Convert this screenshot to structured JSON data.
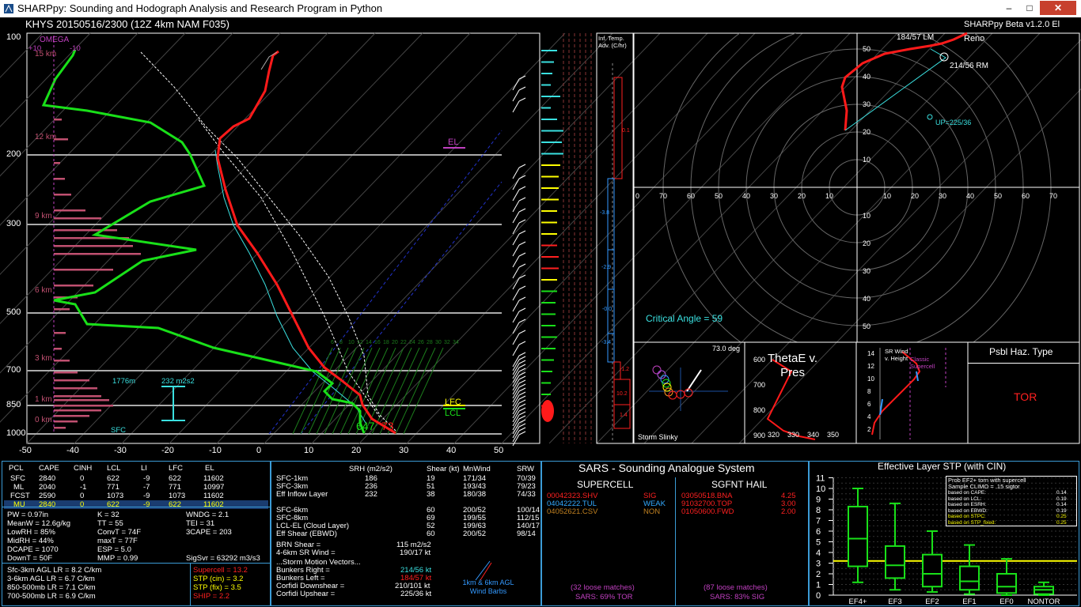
{
  "window": {
    "title": "SHARPpy: Sounding and Hodograph Analysis and Research Program in Python",
    "min": "–",
    "max": "□",
    "close": "✕"
  },
  "header": {
    "station": "KHYS   20150516/2300  (12Z  4km NAM  F035)",
    "version": "SHARPpy Beta v1.2.0 El Reno"
  },
  "skewt": {
    "p_labels": [
      "100",
      "200",
      "300",
      "500",
      "700",
      "850",
      "1000"
    ],
    "t_labels": [
      "-50",
      "-40",
      "-30",
      "-20",
      "-10",
      "0",
      "10",
      "20",
      "30",
      "40",
      "50"
    ],
    "h_labels": [
      "15 km",
      "12 km",
      "9 km",
      "6 km",
      "3 km",
      "1 km",
      "0 km"
    ],
    "omega": "OMEGA",
    "omega_ticks": [
      "+10",
      "-10"
    ],
    "el": "EL",
    "lfc": "LFC",
    "lcl": "LCL",
    "sfc": "SFC",
    "eff_h": "1776m",
    "eff_srh": "232 m2s2",
    "sfc_t": "73",
    "sfc_td": "647",
    "wetbulb_labels": [
      "6",
      "8",
      "10",
      "12",
      "14",
      "16",
      "18",
      "20",
      "22",
      "24",
      "26",
      "28",
      "30",
      "32",
      "34"
    ]
  },
  "inf_temp": {
    "title": "Inf. Temp. Adv. (C/hr)",
    "values": [
      "0.1",
      "-3.8",
      "-2.9",
      "-0.0",
      "-3.4",
      "-1.2",
      "10.2",
      "1.4"
    ]
  },
  "hodograph": {
    "lm": "184/57 LM",
    "rm": "214/56 RM",
    "up": "UP=225/36",
    "rings_upper": [
      "50",
      "40",
      "30",
      "20",
      "10"
    ],
    "x_labels": [
      "0",
      "70",
      "60",
      "50",
      "40",
      "30",
      "20",
      "10",
      "10",
      "20",
      "30",
      "40",
      "50",
      "60",
      "70"
    ],
    "rings_lower": [
      "10",
      "20",
      "30",
      "40",
      "50"
    ],
    "critical_angle": "Critical Angle = 59"
  },
  "slinky": {
    "angle": "73.0 deg",
    "label": "Storm Slinky"
  },
  "thetae": {
    "title": "ThetaE v.\nPres",
    "p_labels": [
      "600",
      "700",
      "800",
      "900"
    ],
    "t_labels": [
      "320",
      "330",
      "340",
      "350"
    ]
  },
  "srwind": {
    "label": "SR Wind v. Height",
    "classic": "Classic Supercell",
    "h_labels": [
      "14",
      "12",
      "10",
      "8",
      "6",
      "4",
      "2"
    ]
  },
  "haz": {
    "title": "Psbl Haz. Type",
    "value": "TOR"
  },
  "parcels": {
    "headers": [
      "PCL",
      "CAPE",
      "CINH",
      "LCL",
      "LI",
      "LFC",
      "EL"
    ],
    "rows": [
      [
        "SFC",
        "2840",
        "0",
        "622",
        "-9",
        "622",
        "11602"
      ],
      [
        "ML",
        "2040",
        "-1",
        "771",
        "-7",
        "771",
        "10997"
      ],
      [
        "FCST",
        "2590",
        "0",
        "1073",
        "-9",
        "1073",
        "11602"
      ],
      [
        "MU",
        "2840",
        "0",
        "622",
        "-9",
        "622",
        "11602"
      ]
    ]
  },
  "indices": [
    [
      "PW = 0.97in",
      "K = 32",
      "WNDG = 2.1"
    ],
    [
      "MeanW = 12.6g/kg",
      "TT = 55",
      "TEI = 31"
    ],
    [
      "LowRH = 85%",
      "ConvT = 74F",
      "3CAPE = 203"
    ],
    [
      "MidRH = 44%",
      "maxT = 77F",
      ""
    ],
    [
      "DCAPE = 1070",
      "ESP = 5.0",
      ""
    ],
    [
      "DownT = 50F",
      "MMP = 0.99",
      "SigSvr = 63292 m3/s3"
    ]
  ],
  "lapse": [
    "Sfc-3km AGL LR = 8.2 C/km",
    "3-6km AGL LR = 6.7 C/km",
    "850-500mb LR = 7.1 C/km",
    "700-500mb LR = 6.9 C/km"
  ],
  "composite": [
    {
      "text": "Supercell = 13.2",
      "color": "#ff2020"
    },
    {
      "text": "STP (cin) = 3.2",
      "color": "#ffff00"
    },
    {
      "text": "STP (fix) = 3.5",
      "color": "#ffff00"
    },
    {
      "text": "SHIP = 2.2",
      "color": "#ff2020"
    }
  ],
  "kinematics": {
    "headers": [
      "",
      "SRH (m2/s2)",
      "Shear (kt)",
      "MnWind",
      "SRW"
    ],
    "rows": [
      [
        "SFC-1km",
        "186",
        "19",
        "171/34",
        "70/39"
      ],
      [
        "SFC-3km",
        "236",
        "51",
        "193/43",
        "79/23"
      ],
      [
        "Eff Inflow Layer",
        "232",
        "38",
        "180/38",
        "74/33"
      ],
      [
        "",
        "",
        "",
        "",
        ""
      ],
      [
        "SFC-6km",
        "",
        "60",
        "200/52",
        "100/14"
      ],
      [
        "SFC-8km",
        "",
        "69",
        "199/55",
        "112/15"
      ],
      [
        "LCL-EL (Cloud Layer)",
        "",
        "52",
        "199/63",
        "140/17"
      ],
      [
        "Eff Shear (EBWD)",
        "",
        "60",
        "200/52",
        "98/14"
      ]
    ],
    "brn": "BRN Shear =",
    "brn_v": "115 m2/s2",
    "sr46": "4-6km SR Wind =",
    "sr46_v": "190/17 kt",
    "motion": "...Storm Motion Vectors...",
    "bright": "Bunkers Right =",
    "bright_v": "214/56 kt",
    "bleft": "Bunkers Left =",
    "bleft_v": "184/57 kt",
    "cdown": "Corfidi Downshear =",
    "cdown_v": "210/101 kt",
    "cup": "Corfidi Upshear =",
    "cup_v": "225/36 kt",
    "barbs": "1km & 6km AGL Wind Barbs"
  },
  "sars": {
    "title": "SARS - Sounding Analogue System",
    "supercell": "SUPERCELL",
    "hail": "SGFNT HAIL",
    "sc_matches": [
      {
        "id": "00042323.SHV",
        "type": "SIG",
        "color": "#ff2020"
      },
      {
        "id": "04042222.TUL",
        "type": "WEAK",
        "color": "#33aaff"
      },
      {
        "id": "04052621.CSV",
        "type": "NON",
        "color": "#c08020"
      }
    ],
    "hail_matches": [
      {
        "id": "03050518.BNA",
        "val": "4.25"
      },
      {
        "id": "91032700.TOP",
        "val": "3.00"
      },
      {
        "id": "01050600.FWD",
        "val": "2.00"
      }
    ],
    "sc_loose": "(32 loose matches)",
    "sc_result": "SARS: 69% TOR",
    "hail_loose": "(87 loose matches)",
    "hail_result": "SARS: 83% SIG"
  },
  "stp": {
    "title": "Effective Layer STP (with CIN)",
    "y_labels": [
      "11",
      "10",
      "9",
      "8",
      "7",
      "6",
      "5",
      "4",
      "3",
      "2",
      "1",
      "0"
    ],
    "x_labels": [
      "EF4+",
      "EF3",
      "EF2",
      "EF1",
      "EF0",
      "NONTOR"
    ],
    "legend_title": "Prob EF2+ torn with supercell",
    "legend_sub": "Sample CLIMO = .15 sigtor",
    "legend_rows": [
      {
        "label": "based on CAPE:",
        "val": "0.14"
      },
      {
        "label": "based on LCL:",
        "val": "0.19"
      },
      {
        "label": "based on ESRH:",
        "val": "0.14"
      },
      {
        "label": "based on EBWD:",
        "val": "0.19"
      },
      {
        "label": "based on STPC:",
        "val": "0.25"
      },
      {
        "label": "based on STP_fixed:",
        "val": "0.25"
      }
    ],
    "boxes": [
      {
        "min": 1.2,
        "q1": 2.7,
        "med": 5.3,
        "q3": 8.3,
        "max": 10.0
      },
      {
        "min": 0.5,
        "q1": 1.6,
        "med": 2.8,
        "q3": 4.6,
        "max": 8.6
      },
      {
        "min": 0.3,
        "q1": 0.8,
        "med": 2.0,
        "q3": 3.8,
        "max": 6.0
      },
      {
        "min": 0.1,
        "q1": 0.5,
        "med": 1.3,
        "q3": 2.7,
        "max": 4.7
      },
      {
        "min": 0.0,
        "q1": 0.2,
        "med": 0.8,
        "q3": 2.0,
        "max": 3.4
      },
      {
        "min": 0.0,
        "q1": 0.1,
        "med": 0.5,
        "q3": 0.8,
        "max": 1.2
      }
    ],
    "stp_value": 3.2
  }
}
